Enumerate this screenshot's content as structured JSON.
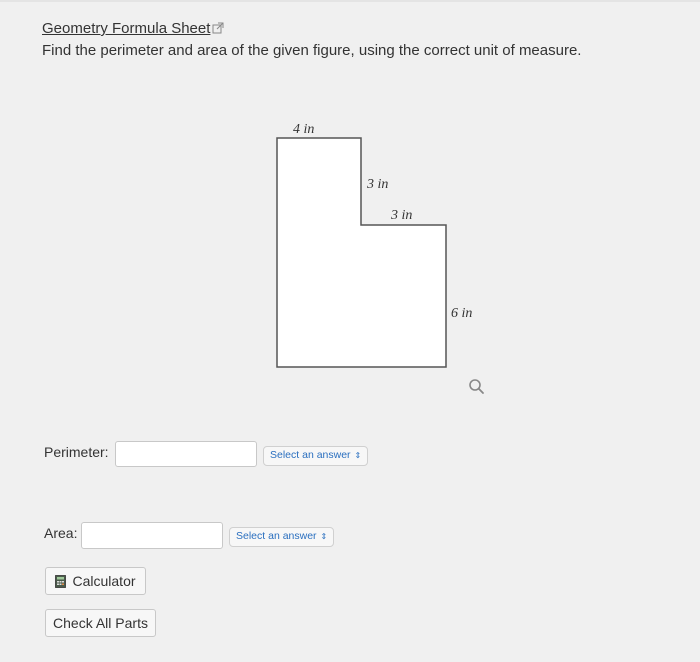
{
  "header": {
    "formula_link": "Geometry Formula Sheet",
    "instructions": "Find the perimeter and area of the given figure, using the correct unit of measure."
  },
  "figure": {
    "labels": {
      "top": "4 in",
      "inner_vertical": "3 in",
      "inner_horizontal": "3 in",
      "right": "6 in"
    }
  },
  "perimeter": {
    "label": "Perimeter:",
    "value": "",
    "unit_select": "Select an answer"
  },
  "area": {
    "label": "Area:",
    "value": "",
    "unit_select": "Select an answer"
  },
  "buttons": {
    "calculator": "Calculator",
    "check_all": "Check All Parts"
  },
  "colors": {
    "background": "#f0f0f0",
    "select_text": "#2a6fbf",
    "figure_stroke": "#555555"
  }
}
